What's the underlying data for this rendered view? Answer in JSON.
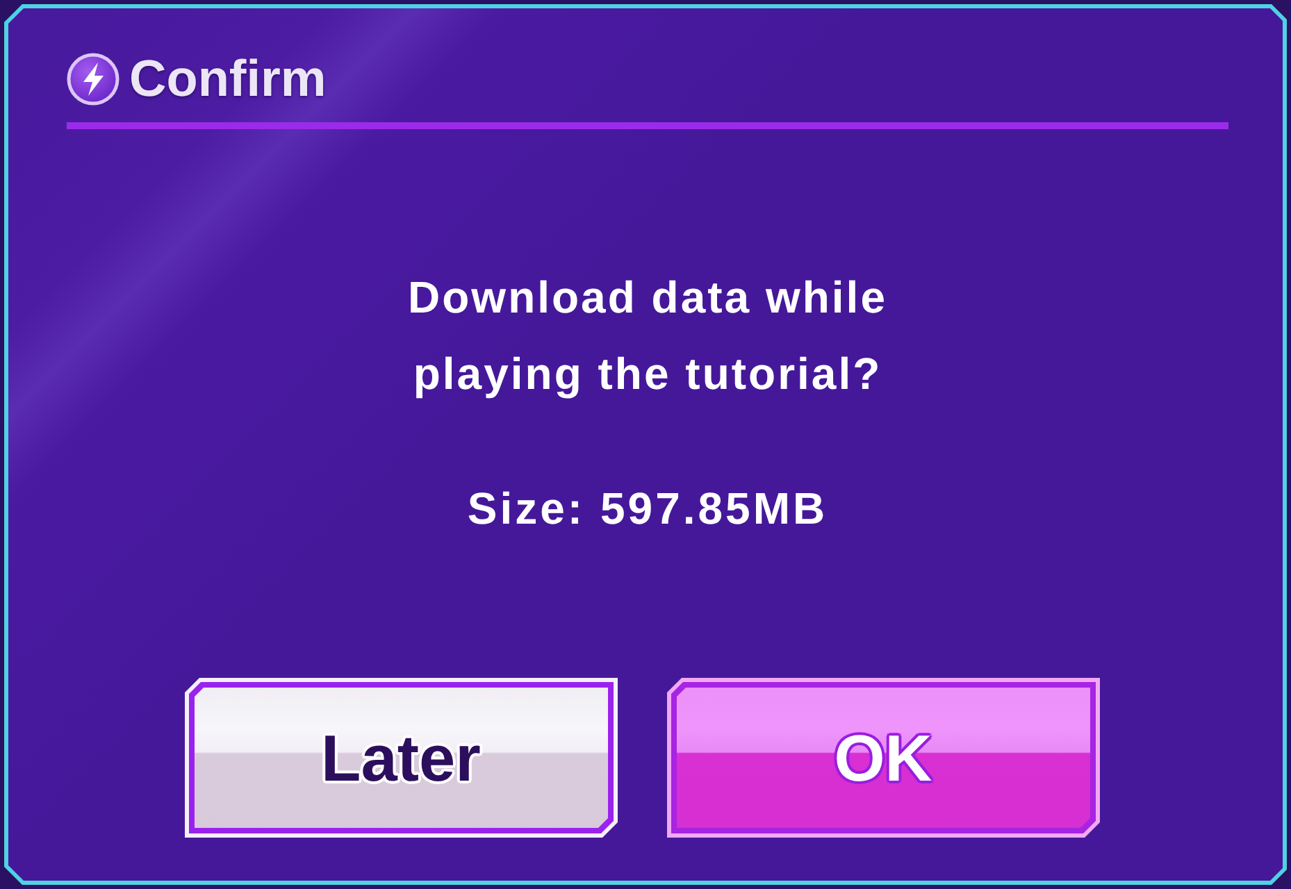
{
  "dialog": {
    "title": "Confirm",
    "message_lines": [
      "Download data while",
      "playing the tutorial?"
    ],
    "size": "Size: 597.85MB",
    "buttons": [
      {
        "label": "Later",
        "kind": "secondary"
      },
      {
        "label": "OK",
        "kind": "primary"
      }
    ]
  }
}
